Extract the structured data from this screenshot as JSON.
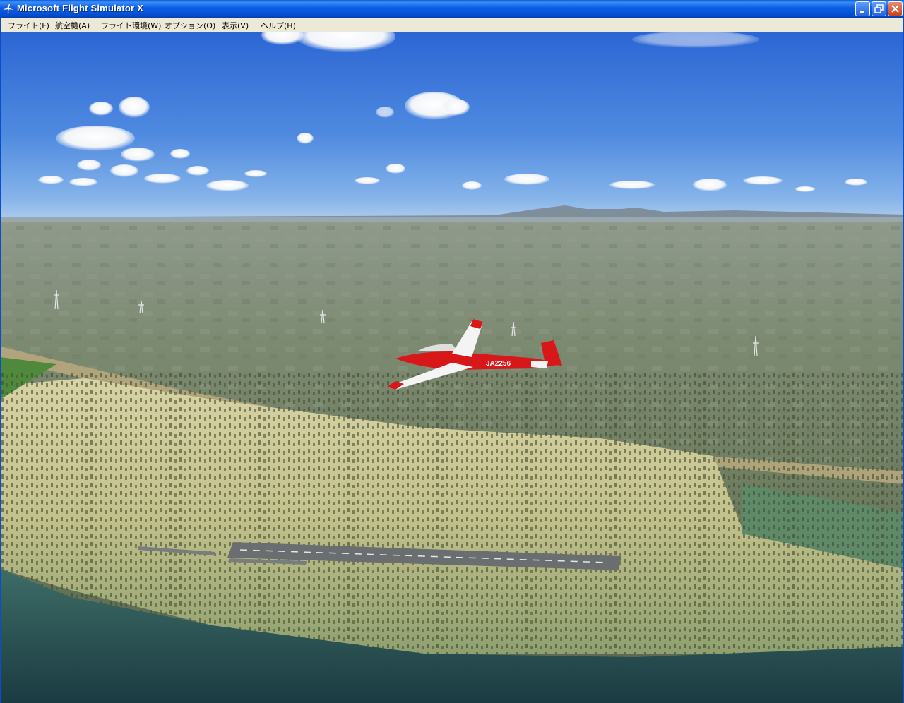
{
  "window": {
    "title": "Microsoft Flight Simulator X",
    "icon": "airplane-icon",
    "controls": [
      "minimize-icon",
      "restore-icon",
      "close-icon"
    ]
  },
  "menu": {
    "items": [
      {
        "label": "フライト(F)"
      },
      {
        "label": "航空機(A)"
      },
      {
        "label": "フライト環境(W)"
      },
      {
        "label": "オプション(O)"
      },
      {
        "label": "表示(V)"
      },
      {
        "label": "ヘルプ(H)"
      }
    ]
  },
  "scene": {
    "aircraft_registration": "JA2256",
    "aircraft_color": "#d81818",
    "sky_top": "#2f6fd8",
    "sky_horizon": "#9cc3ec"
  }
}
